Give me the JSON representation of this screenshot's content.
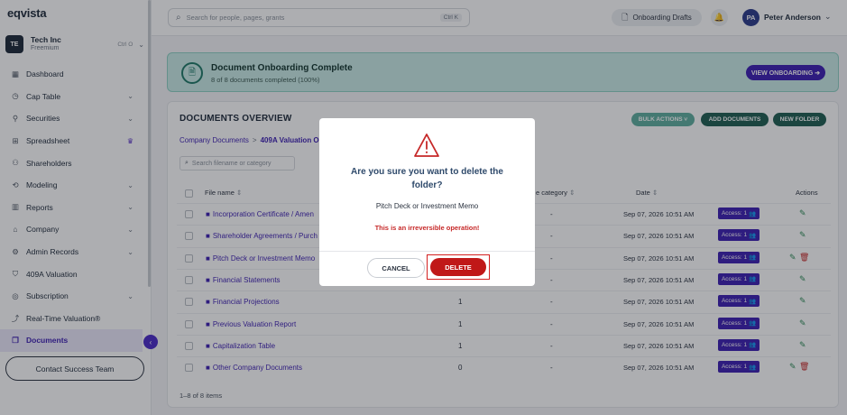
{
  "app": {
    "logo": "eqvista"
  },
  "company": {
    "initials": "TE",
    "name": "Tech Inc",
    "plan": "Freemium",
    "shortcut": "Ctrl O"
  },
  "sidebar": {
    "items": [
      {
        "label": "Dashboard",
        "icon": "dashboard-icon",
        "chevron": false
      },
      {
        "label": "Cap Table",
        "icon": "cap-table-icon",
        "chevron": true
      },
      {
        "label": "Securities",
        "icon": "securities-icon",
        "chevron": true
      },
      {
        "label": "Spreadsheet",
        "icon": "spreadsheet-icon",
        "crown": true
      },
      {
        "label": "Shareholders",
        "icon": "shareholders-icon",
        "chevron": false
      },
      {
        "label": "Modeling",
        "icon": "modeling-icon",
        "chevron": true
      },
      {
        "label": "Reports",
        "icon": "reports-icon",
        "chevron": true
      },
      {
        "label": "Company",
        "icon": "company-icon",
        "chevron": true
      },
      {
        "label": "Admin Records",
        "icon": "admin-records-icon",
        "chevron": true
      },
      {
        "label": "409A Valuation",
        "icon": "valuation-icon",
        "chevron": false
      },
      {
        "label": "Subscription",
        "icon": "subscription-icon",
        "chevron": true
      },
      {
        "label": "Real-Time Valuation®",
        "icon": "realtime-valuation-icon",
        "chevron": false
      },
      {
        "label": "Documents",
        "icon": "documents-icon",
        "chevron": false,
        "active": true
      }
    ],
    "contact_label": "Contact Success Team"
  },
  "topbar": {
    "search_placeholder": "Search for people, pages, grants",
    "search_shortcut": "Ctrl K",
    "drafts_label": "Onboarding Drafts",
    "user_initials": "PA",
    "user_name": "Peter Anderson"
  },
  "banner": {
    "title": "Document Onboarding Complete",
    "subtitle": "8 of 8 documents completed (100%)",
    "button_label": "VIEW ONBOARDING ➔"
  },
  "documents": {
    "title": "DOCUMENTS OVERVIEW",
    "bulk_label": "BULK ACTIONS ˅",
    "add_label": "ADD DOCUMENTS",
    "folder_label": "NEW FOLDER",
    "breadcrumb_root": "Company Documents",
    "breadcrumb_current": "409A Valuation O",
    "filter_placeholder": "Search filename or category",
    "columns": {
      "name": "File name",
      "category": "e category",
      "date": "Date",
      "actions": "Actions"
    },
    "rows": [
      {
        "name": "Incorporation Certificate / Amen",
        "count": "",
        "category": "-",
        "date": "Sep 07, 2026 10:51 AM",
        "access": "Access: 1",
        "delete": false
      },
      {
        "name": "Shareholder Agreements / Purch",
        "count": "",
        "category": "-",
        "date": "Sep 07, 2026 10:51 AM",
        "access": "Access: 1",
        "delete": false
      },
      {
        "name": "Pitch Deck or Investment Memo",
        "count": "",
        "category": "-",
        "date": "Sep 07, 2026 10:51 AM",
        "access": "Access: 1",
        "delete": true
      },
      {
        "name": "Financial Statements",
        "count": "",
        "category": "-",
        "date": "Sep 07, 2026 10:51 AM",
        "access": "Access: 1",
        "delete": false
      },
      {
        "name": "Financial Projections",
        "count": "1",
        "category": "-",
        "date": "Sep 07, 2026 10:51 AM",
        "access": "Access: 1",
        "delete": false
      },
      {
        "name": "Previous Valuation Report",
        "count": "1",
        "category": "-",
        "date": "Sep 07, 2026 10:51 AM",
        "access": "Access: 1",
        "delete": false
      },
      {
        "name": "Capitalization Table",
        "count": "1",
        "category": "-",
        "date": "Sep 07, 2026 10:51 AM",
        "access": "Access: 1",
        "delete": false
      },
      {
        "name": "Other Company Documents",
        "count": "0",
        "category": "-",
        "date": "Sep 07, 2026 10:51 AM",
        "access": "Access: 1",
        "delete": true
      }
    ],
    "footer": "1–8 of 8 items"
  },
  "modal": {
    "title": "Are you sure you want to delete the folder?",
    "folder_name": "Pitch Deck or Investment Memo",
    "warning": "This is an irreversible operation!",
    "cancel_label": "CANCEL",
    "delete_label": "DELETE"
  },
  "colors": {
    "accent": "#3d1fb2",
    "danger": "#c01818",
    "teal": "#1f5e52"
  }
}
